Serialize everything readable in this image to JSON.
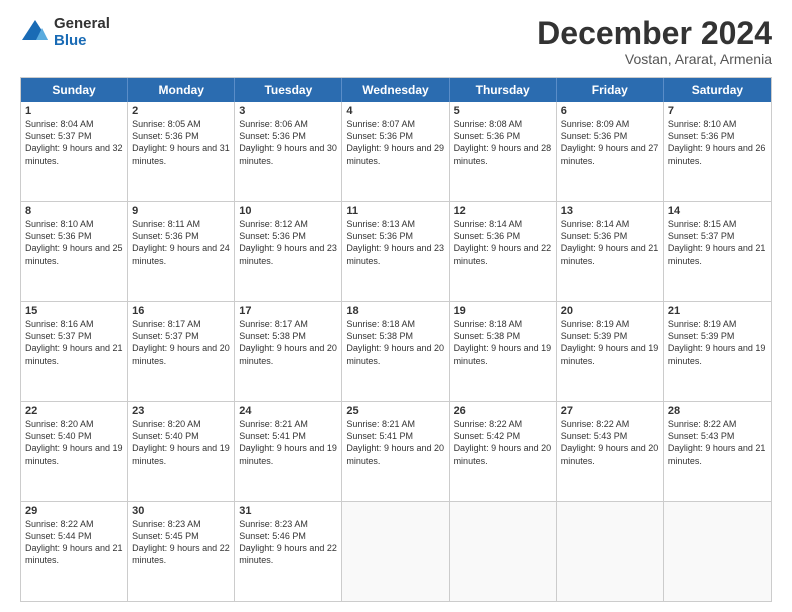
{
  "logo": {
    "general": "General",
    "blue": "Blue"
  },
  "title": {
    "month": "December 2024",
    "location": "Vostan, Ararat, Armenia"
  },
  "calendar": {
    "headers": [
      "Sunday",
      "Monday",
      "Tuesday",
      "Wednesday",
      "Thursday",
      "Friday",
      "Saturday"
    ],
    "rows": [
      [
        {
          "day": "1",
          "sunrise": "8:04 AM",
          "sunset": "5:37 PM",
          "daylight": "9 hours and 32 minutes."
        },
        {
          "day": "2",
          "sunrise": "8:05 AM",
          "sunset": "5:36 PM",
          "daylight": "9 hours and 31 minutes."
        },
        {
          "day": "3",
          "sunrise": "8:06 AM",
          "sunset": "5:36 PM",
          "daylight": "9 hours and 30 minutes."
        },
        {
          "day": "4",
          "sunrise": "8:07 AM",
          "sunset": "5:36 PM",
          "daylight": "9 hours and 29 minutes."
        },
        {
          "day": "5",
          "sunrise": "8:08 AM",
          "sunset": "5:36 PM",
          "daylight": "9 hours and 28 minutes."
        },
        {
          "day": "6",
          "sunrise": "8:09 AM",
          "sunset": "5:36 PM",
          "daylight": "9 hours and 27 minutes."
        },
        {
          "day": "7",
          "sunrise": "8:10 AM",
          "sunset": "5:36 PM",
          "daylight": "9 hours and 26 minutes."
        }
      ],
      [
        {
          "day": "8",
          "sunrise": "8:10 AM",
          "sunset": "5:36 PM",
          "daylight": "9 hours and 25 minutes."
        },
        {
          "day": "9",
          "sunrise": "8:11 AM",
          "sunset": "5:36 PM",
          "daylight": "9 hours and 24 minutes."
        },
        {
          "day": "10",
          "sunrise": "8:12 AM",
          "sunset": "5:36 PM",
          "daylight": "9 hours and 23 minutes."
        },
        {
          "day": "11",
          "sunrise": "8:13 AM",
          "sunset": "5:36 PM",
          "daylight": "9 hours and 23 minutes."
        },
        {
          "day": "12",
          "sunrise": "8:14 AM",
          "sunset": "5:36 PM",
          "daylight": "9 hours and 22 minutes."
        },
        {
          "day": "13",
          "sunrise": "8:14 AM",
          "sunset": "5:36 PM",
          "daylight": "9 hours and 21 minutes."
        },
        {
          "day": "14",
          "sunrise": "8:15 AM",
          "sunset": "5:37 PM",
          "daylight": "9 hours and 21 minutes."
        }
      ],
      [
        {
          "day": "15",
          "sunrise": "8:16 AM",
          "sunset": "5:37 PM",
          "daylight": "9 hours and 21 minutes."
        },
        {
          "day": "16",
          "sunrise": "8:17 AM",
          "sunset": "5:37 PM",
          "daylight": "9 hours and 20 minutes."
        },
        {
          "day": "17",
          "sunrise": "8:17 AM",
          "sunset": "5:38 PM",
          "daylight": "9 hours and 20 minutes."
        },
        {
          "day": "18",
          "sunrise": "8:18 AM",
          "sunset": "5:38 PM",
          "daylight": "9 hours and 20 minutes."
        },
        {
          "day": "19",
          "sunrise": "8:18 AM",
          "sunset": "5:38 PM",
          "daylight": "9 hours and 19 minutes."
        },
        {
          "day": "20",
          "sunrise": "8:19 AM",
          "sunset": "5:39 PM",
          "daylight": "9 hours and 19 minutes."
        },
        {
          "day": "21",
          "sunrise": "8:19 AM",
          "sunset": "5:39 PM",
          "daylight": "9 hours and 19 minutes."
        }
      ],
      [
        {
          "day": "22",
          "sunrise": "8:20 AM",
          "sunset": "5:40 PM",
          "daylight": "9 hours and 19 minutes."
        },
        {
          "day": "23",
          "sunrise": "8:20 AM",
          "sunset": "5:40 PM",
          "daylight": "9 hours and 19 minutes."
        },
        {
          "day": "24",
          "sunrise": "8:21 AM",
          "sunset": "5:41 PM",
          "daylight": "9 hours and 19 minutes."
        },
        {
          "day": "25",
          "sunrise": "8:21 AM",
          "sunset": "5:41 PM",
          "daylight": "9 hours and 20 minutes."
        },
        {
          "day": "26",
          "sunrise": "8:22 AM",
          "sunset": "5:42 PM",
          "daylight": "9 hours and 20 minutes."
        },
        {
          "day": "27",
          "sunrise": "8:22 AM",
          "sunset": "5:43 PM",
          "daylight": "9 hours and 20 minutes."
        },
        {
          "day": "28",
          "sunrise": "8:22 AM",
          "sunset": "5:43 PM",
          "daylight": "9 hours and 21 minutes."
        }
      ],
      [
        {
          "day": "29",
          "sunrise": "8:22 AM",
          "sunset": "5:44 PM",
          "daylight": "9 hours and 21 minutes."
        },
        {
          "day": "30",
          "sunrise": "8:23 AM",
          "sunset": "5:45 PM",
          "daylight": "9 hours and 22 minutes."
        },
        {
          "day": "31",
          "sunrise": "8:23 AM",
          "sunset": "5:46 PM",
          "daylight": "9 hours and 22 minutes."
        },
        null,
        null,
        null,
        null
      ]
    ]
  }
}
